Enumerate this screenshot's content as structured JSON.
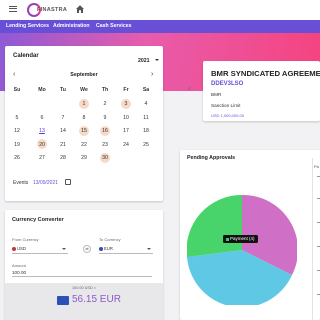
{
  "app": {
    "logo_text": "FINASTRA"
  },
  "nav": {
    "items": [
      "Lending Services",
      "Administration",
      "Cash Services"
    ]
  },
  "calendar": {
    "title": "Calendar",
    "year": "2021",
    "month": "September",
    "weekdays": [
      "Su",
      "Mo",
      "Tu",
      "We",
      "Th",
      "Fr",
      "Sa"
    ],
    "rows": [
      [
        "",
        "",
        "",
        "1",
        "2",
        "3",
        "4"
      ],
      [
        "5",
        "6",
        "7",
        "8",
        "9",
        "10",
        "11"
      ],
      [
        "12",
        "13",
        "14",
        "15",
        "16",
        "17",
        "18"
      ],
      [
        "19",
        "20",
        "21",
        "22",
        "23",
        "24",
        "25"
      ],
      [
        "26",
        "27",
        "28",
        "29",
        "30",
        "",
        ""
      ]
    ],
    "highlighted_days": [
      "1",
      "3",
      "15",
      "16",
      "20",
      "30"
    ],
    "today": "13",
    "events_label": "Events",
    "events_date": "13/09/2021"
  },
  "deal": {
    "title": "BMR SYNDICATED AGREEMENT",
    "ref": "DDEV3LSO",
    "entity": "BMR",
    "status": "Sanction Limit",
    "amount": "USD 1,000,000.00"
  },
  "approvals": {
    "title": "Pending Approvals",
    "tooltip": "Payment (4)",
    "side_label": "Pa"
  },
  "converter": {
    "title": "Currency Converter",
    "from_label": "From Currency",
    "from_value": "USD",
    "to_label": "To Currency",
    "to_value": "EUR",
    "amount_label": "Amount",
    "amount_value": "100.00",
    "result_sub": "100.00 USD =",
    "result_value": "56.15 EUR"
  },
  "colors": {
    "nav": "#694ed6",
    "accent": "#6a4ed6",
    "pie_green": "#48d46a",
    "pie_purple": "#cf6fc6",
    "pie_blue": "#5ec8e5"
  }
}
